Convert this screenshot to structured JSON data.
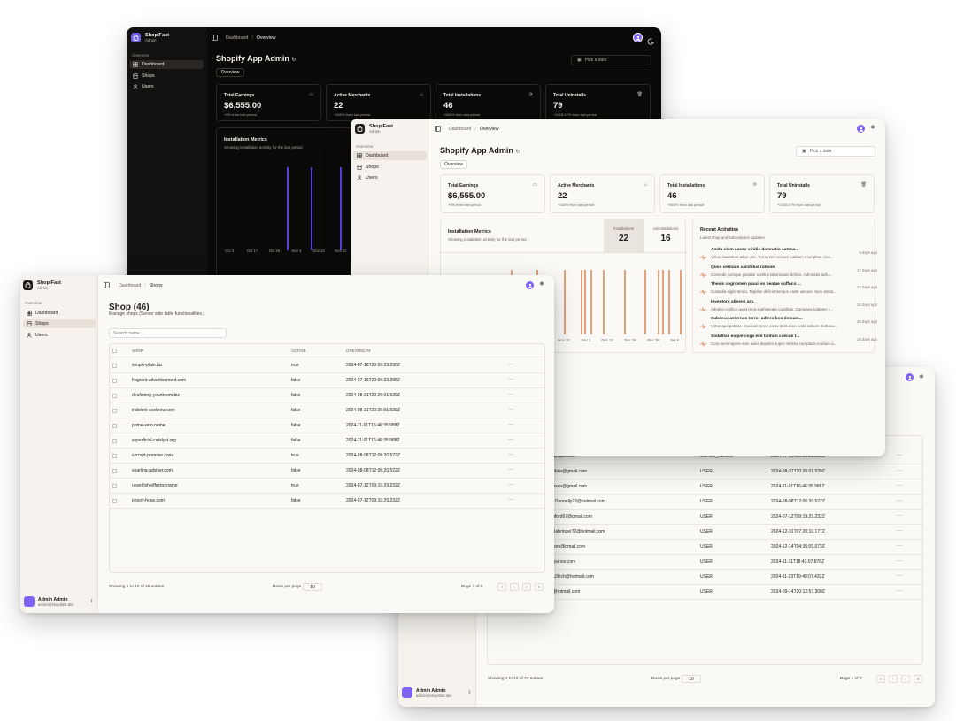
{
  "brand": {
    "name": "ShopiFast",
    "sub": "Admin"
  },
  "nav": {
    "group": "Overview",
    "items": [
      "Dashboard",
      "Shops",
      "Users"
    ]
  },
  "breadcrumb": {
    "dashboard": "Dashboard",
    "overview": "Overview",
    "shops": "Shops"
  },
  "dashboard": {
    "title": "Shopify App Admin",
    "tab": "Overview",
    "date_placeholder": "Pick a date",
    "cards": [
      {
        "label": "Total Earnings",
        "value": "$6,555.00",
        "sub": "+0% from last period"
      },
      {
        "label": "Active Merchants",
        "value": "22",
        "sub": "+340% from last period"
      },
      {
        "label": "Total Installations",
        "value": "46",
        "sub": "+560% from last period"
      },
      {
        "label": "Total Uninstalls",
        "value": "79",
        "sub": "+1028.57% from last period"
      }
    ],
    "metrics_title": "Installation Metrics",
    "metrics_sub": "Showing installation activity for the last period",
    "install_label": "Installations",
    "install_value": "22",
    "uninstall_label": "Uninstallations",
    "uninstall_value": "16",
    "dark_x_labels": [
      "Oct 3",
      "Oct 17",
      "Oct 26",
      "Nov 4",
      "Nov 13",
      "Nov 22"
    ],
    "light_x_labels": [
      "Nov 22",
      "Dec 1",
      "Dec 10",
      "Dec 19",
      "Dec 28",
      "Jan 6"
    ],
    "activities_title": "Recent Activities",
    "activities_sub": "Latest shop and subscription updates",
    "activities": [
      {
        "title": "Amita clam casso viridis damnatio catena...",
        "desc": "Virtus claustrum adus uter. Terra reim veniam cubitum triumphus cras...",
        "time": "5 days ago"
      },
      {
        "title": "Quos cernuus candidus ratione.",
        "desc": "Concede cumque pariatur sortitus laboriosam deficio. Admiratio bellu...",
        "time": "17 days ago"
      },
      {
        "title": "Thesis cognomen pauci ex beatae suffoco ...",
        "desc": "Custodia vigilo tenda. Tepidus deficio tempus caste vacuus. Sum amita...",
        "time": "24 days ago"
      },
      {
        "title": "Inventore absens arx.",
        "desc": "Adeptio confico quod rena sophismata cupiditas. Campana tutamen t...",
        "time": "24 days ago"
      },
      {
        "title": "Subseco aeternus terror adfero bos demum...",
        "desc": "Virtus quo portate. Coeruso teres vorax demulceo unde adsum. Subsea...",
        "time": "26 days ago"
      },
      {
        "title": "Sodalitas eaque coga exe tantum caecus t...",
        "desc": "Cura summopere sum adeo depulso super minima campana conduro a...",
        "time": "28 days ago"
      }
    ]
  },
  "shops": {
    "title": "Shop (46)",
    "subtitle": "Manage shops (Server side table functionalities.)",
    "search_placeholder": "Search name...",
    "columns": [
      "SHOP",
      "ACTIVE",
      "CREATED AT"
    ],
    "rows": [
      {
        "shop": "simple-plain.biz",
        "active": "true",
        "created": "2024-07-16T20:09:23.295Z"
      },
      {
        "shop": "fragrant-advertisement.com",
        "active": "false",
        "created": "2024-07-16T20:09:23.295Z"
      },
      {
        "shop": "deafening-yourtroom.biz",
        "active": "false",
        "created": "2024-08-31T20:26:01.539Z"
      },
      {
        "shop": "indolent-soebrow.com",
        "active": "false",
        "created": "2024-08-31T20:26:01.539Z"
      },
      {
        "shop": "prime-veto.name",
        "active": "false",
        "created": "2024-11-01T16:46:35.988Z"
      },
      {
        "shop": "superficial-catalyst.org",
        "active": "false",
        "created": "2024-11-01T16:46:35.988Z"
      },
      {
        "shop": "corrupt-promise.com",
        "active": "true",
        "created": "2024-08-08T12:06:20.522Z"
      },
      {
        "shop": "snarling-adviser.com",
        "active": "false",
        "created": "2024-08-08T12:06:20.522Z"
      },
      {
        "shop": "unselfish-effector.name",
        "active": "true",
        "created": "2024-07-12T09:19:29.232Z"
      },
      {
        "shop": "phony-hose.com",
        "active": "false",
        "created": "2024-07-12T09:19:29.232Z"
      }
    ],
    "showing": "Showing 1 to 10 of 46 entries",
    "rows_per_page_label": "Rows per page",
    "rows_per_page": "10",
    "page_info": "Page 1 of 5"
  },
  "users": {
    "rows": [
      {
        "email": "...@example.com",
        "role": "SUPER_ADMIN",
        "created": "2024-07-16T20:09:23.295Z"
      },
      {
        "email": "..._Keebler@gmail.com",
        "role": "USER",
        "created": "2024-08-31T20:26:01.539Z"
      },
      {
        "email": "..._Hansen@gmail.com",
        "role": "USER",
        "created": "2024-11-01T16:46:35.988Z"
      },
      {
        "email": "...Mills-Donnelly22@hotmail.com",
        "role": "USER",
        "created": "2024-08-08T12:06:20.522Z"
      },
      {
        "email": "..._Sanford67@gmail.com",
        "role": "USER",
        "created": "2024-07-12T09:19:29.232Z"
      },
      {
        "email": "...llie_Bahringer72@hotmail.com",
        "role": "USER",
        "created": "2024-12-31T07:20:10.177Z"
      },
      {
        "email": "...ickinson@gmail.com",
        "role": "USER",
        "created": "2024-12-14T04:35:09.073Z"
      },
      {
        "email": "...17@yahoo.com",
        "role": "USER",
        "created": "2024-11-11T18:43:07.876Z"
      },
      {
        "email": "...hon.Ullrich@hotmail.com",
        "role": "USER",
        "created": "2024-11-23T19:40:07.432Z"
      },
      {
        "email": "...s46@hotmail.com",
        "role": "USER",
        "created": "2024-09-14T20:12:57.309Z"
      }
    ],
    "showing": "Showing 1 to 10 of 23 entries",
    "rows_per_page_label": "Rows per page",
    "rows_per_page": "10",
    "page_info": "Page 1 of 3"
  },
  "account": {
    "name": "Admin Admin",
    "email": "admin@shopifast.dev"
  },
  "colors": {
    "accent_purple": "#5b3fe0",
    "accent_orange": "#e3a07a",
    "dark_bg": "#0b0a09",
    "light_bg": "#fbf9f6"
  }
}
